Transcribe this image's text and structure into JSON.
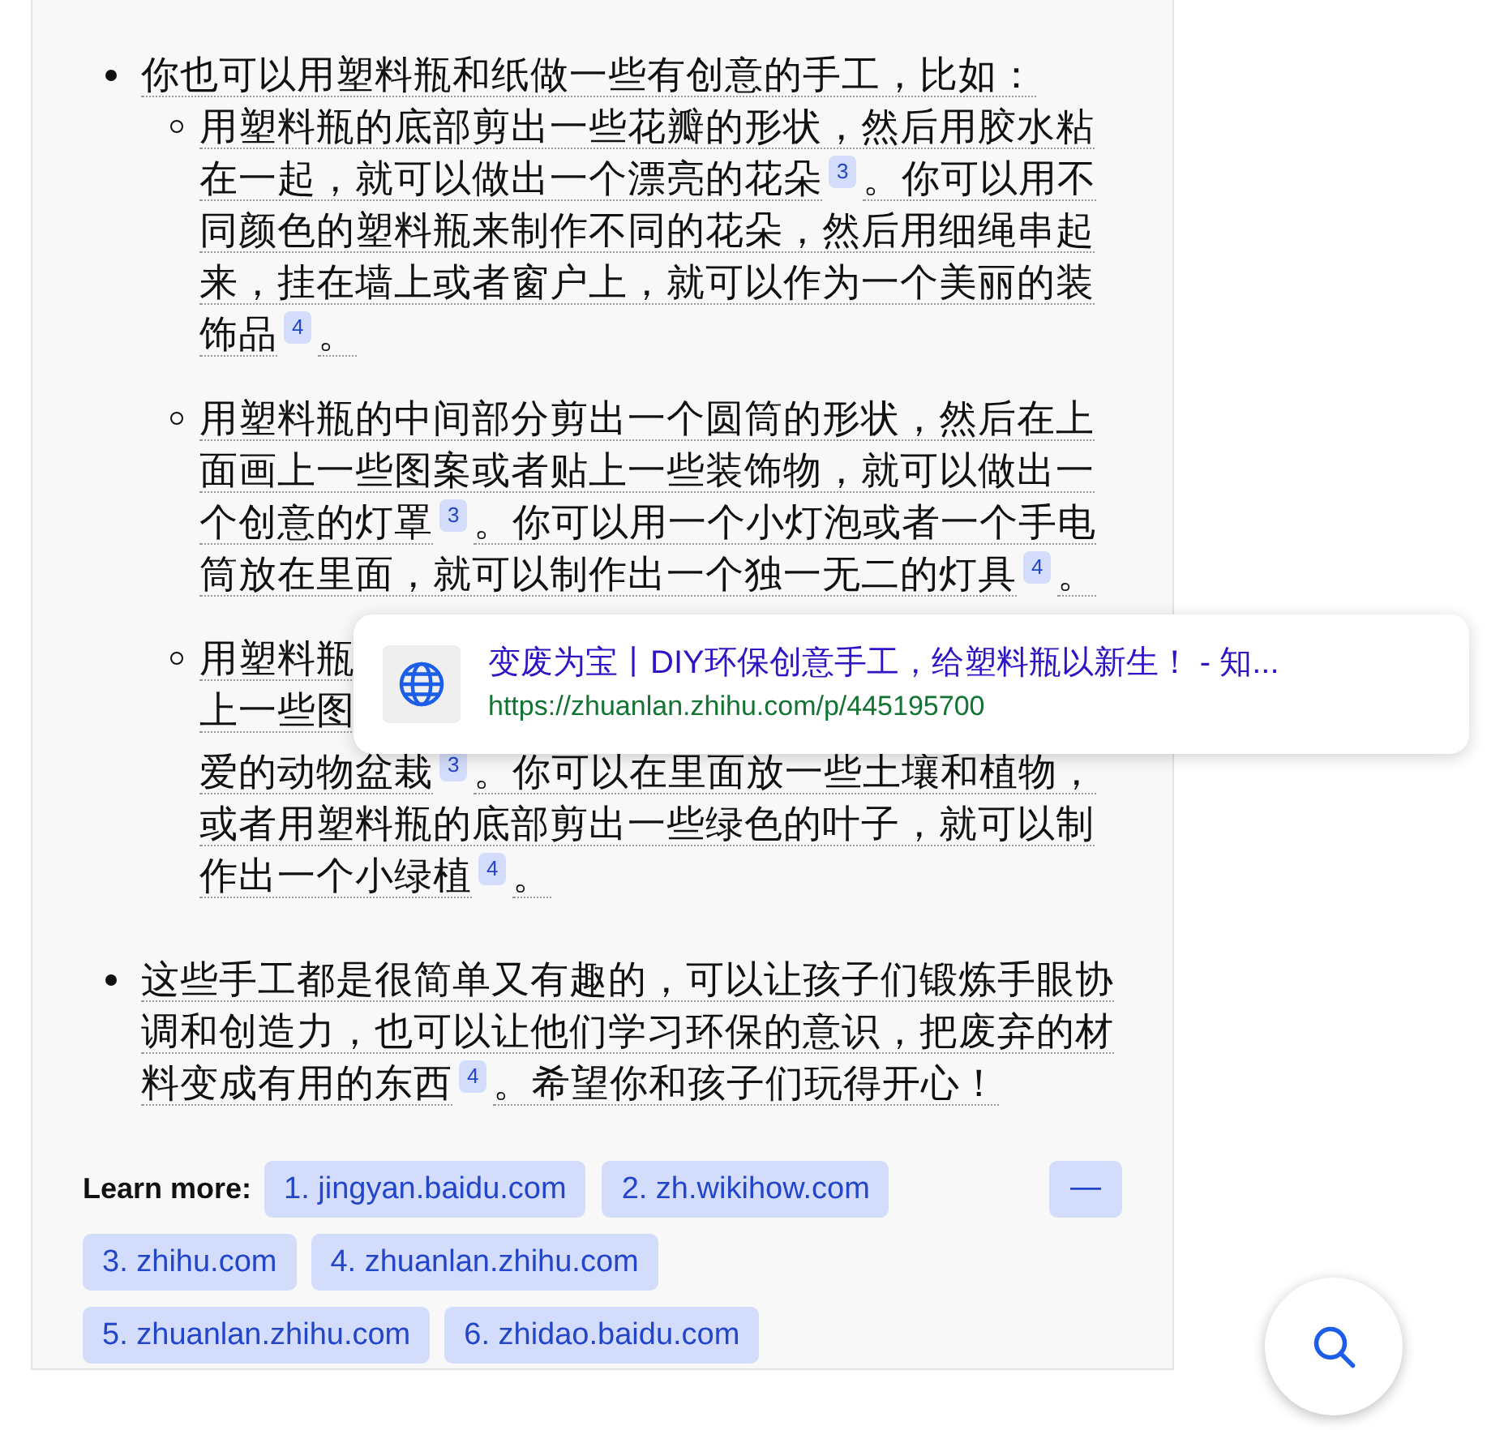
{
  "answer": {
    "items": [
      {
        "segments": [
          {
            "text": "你也可以用塑料瓶和纸做一些有创意的手工，比如："
          }
        ],
        "children": [
          {
            "kind": "paragraph",
            "segments": [
              {
                "text": "用塑料瓶的底部剪出一些花瓣的形状，然后用胶水粘在一起，就可以做出一个漂亮的花朵",
                "cite": "3"
              },
              {
                "text": "。你可以用不同颜色的塑料瓶来制作不同的花朵，然后用细绳串起来，挂在墙上或者窗户上，就可以作为一个美丽的装饰品",
                "cite": "4"
              },
              {
                "text": "。"
              }
            ]
          },
          {
            "kind": "paragraph",
            "segments": [
              {
                "text": "用塑料瓶的中间部分剪出一个圆筒的形状，然后在上面画上一些图案或者贴上一些装饰物，就可以做出一个创意的灯罩",
                "cite": "3"
              },
              {
                "text": "。你可以用一个小灯泡或者一个手电筒放在里面，就可以制作出一个独一无二的灯具",
                "cite": "4"
              },
              {
                "text": "。"
              }
            ]
          },
          {
            "kind": "covered",
            "lines": [
              [
                {
                  "text": "用塑料瓶"
                }
              ],
              [
                {
                  "text": "上一些图"
                }
              ],
              [
                {
                  "text": "爱的动物盆栽",
                  "cite": "3"
                },
                {
                  "text": "。你可以在里面放一些土壤和植物，"
                }
              ],
              [
                {
                  "text": "或者用塑料瓶的底部剪出一些绿色的叶子，就可以制"
                }
              ],
              [
                {
                  "text": "作出一个小绿植",
                  "cite": "4"
                },
                {
                  "text": "。"
                }
              ]
            ]
          }
        ]
      },
      {
        "segments": [
          {
            "text": "这些手工都是很简单又有趣的，可以让孩子们锻炼手眼协调和创造力，也可以让他们学习环保的意识，把废弃的材料变成有用的东西",
            "cite": "4"
          },
          {
            "text": "。希望你和孩子们玩得开心！"
          }
        ]
      }
    ]
  },
  "learn_more": {
    "label": "Learn more:",
    "links": [
      "1. jingyan.baidu.com",
      "2. zh.wikihow.com",
      "3. zhihu.com",
      "4. zhuanlan.zhihu.com",
      "5. zhuanlan.zhihu.com",
      "6. zhidao.baidu.com"
    ],
    "collapse": "—"
  },
  "tooltip": {
    "title": "变废为宝丨DIY环保创意手工，给塑料瓶以新生！ - 知...",
    "url": "https://zhuanlan.zhihu.com/p/445195700"
  }
}
